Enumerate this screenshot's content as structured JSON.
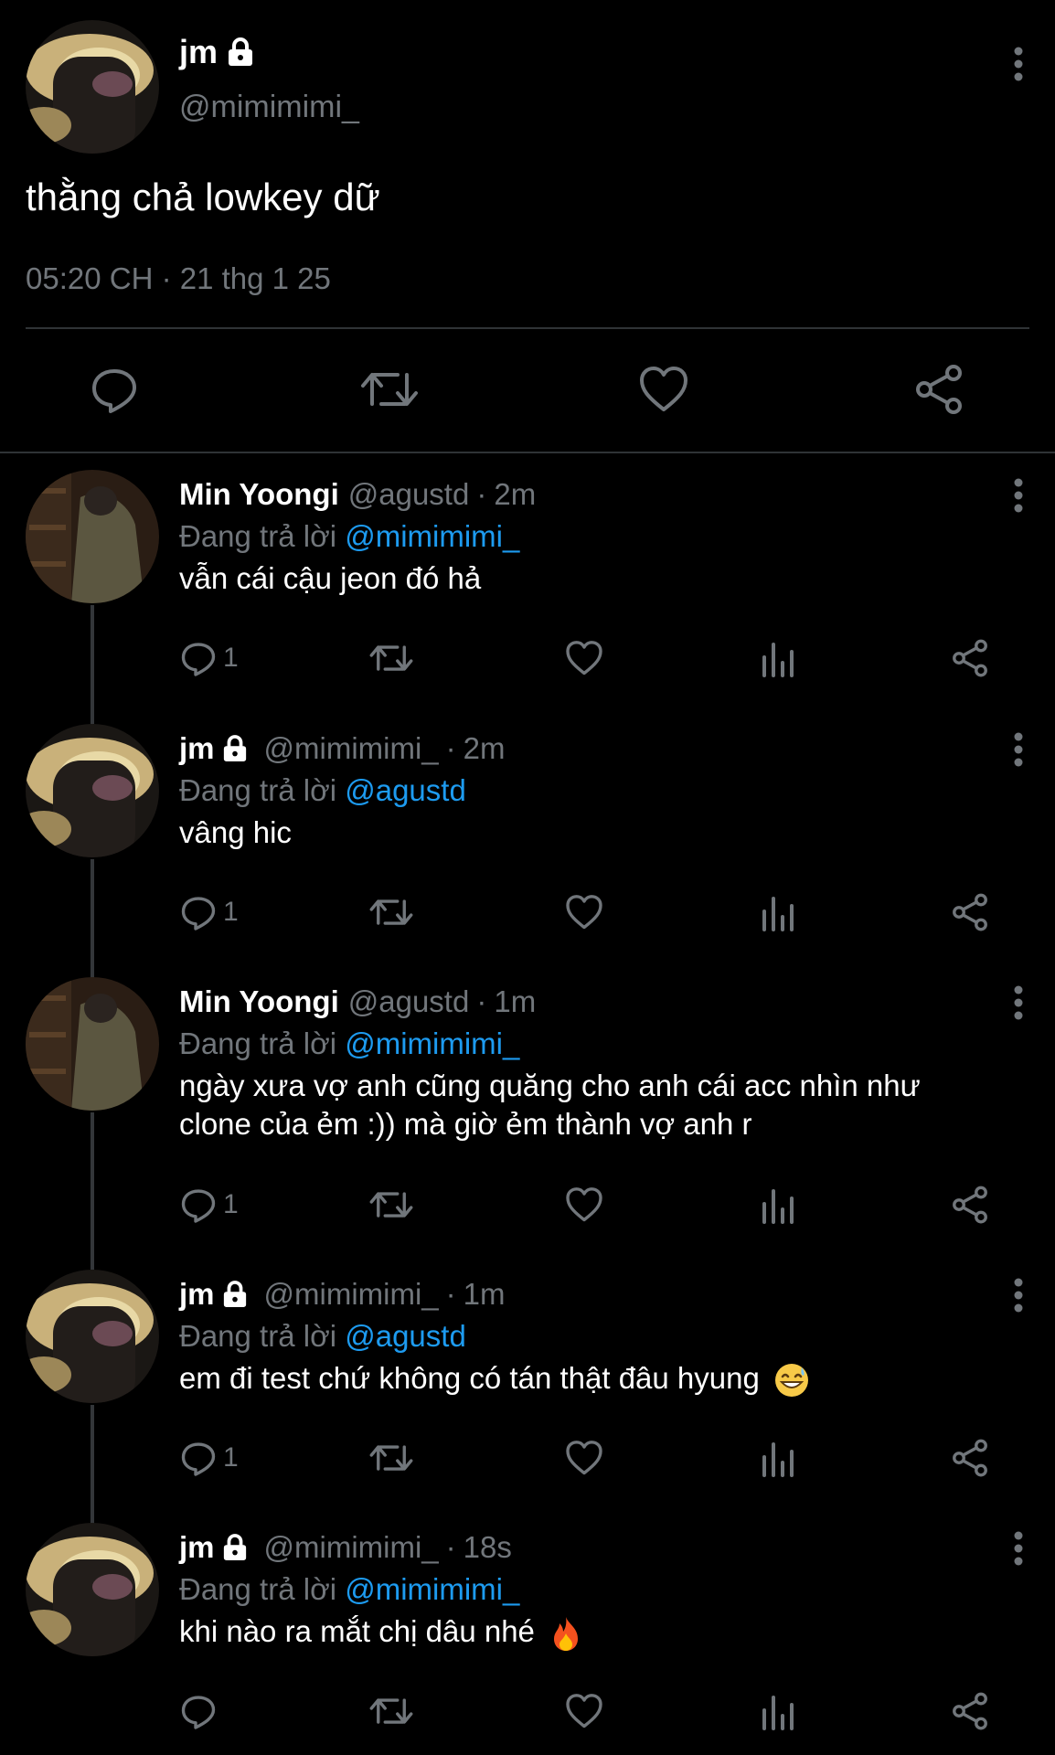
{
  "main_tweet": {
    "name": "jm",
    "handle": "@mimimimi_",
    "text": "thằng chả lowkey dữ",
    "timestamp": "05:20 CH · 21 thg 1 25",
    "actions": [
      "reply-icon",
      "retweet-icon",
      "like-icon",
      "share-icon"
    ]
  },
  "replying_prefix": "Đang trả lời",
  "replies": [
    {
      "name": "Min Yoongi",
      "handle": "@agustd",
      "time": "2m",
      "replying_to": "@mimimimi_",
      "text": "vẫn cái cậu jeon đó hả",
      "reply_count": "1",
      "locked": false,
      "avatar": "green"
    },
    {
      "name": "jm",
      "handle": "@mimimimi_",
      "time": "2m",
      "replying_to": "@agustd",
      "text": "vâng hic",
      "reply_count": "1",
      "locked": true,
      "avatar": "gold"
    },
    {
      "name": "Min Yoongi",
      "handle": "@agustd",
      "time": "1m",
      "replying_to": "@mimimimi_",
      "text": "ngày xưa vợ anh cũng quăng cho anh cái acc nhìn như clone của ẻm :)) mà giờ ẻm thành vợ anh r",
      "reply_count": "1",
      "locked": false,
      "avatar": "green"
    },
    {
      "name": "jm",
      "handle": "@mimimimi_",
      "time": "1m",
      "replying_to": "@agustd",
      "text": "em đi test chứ không có tán thật đâu hyung",
      "emoji": "grinning-sweat-emoji",
      "reply_count": "1",
      "locked": true,
      "avatar": "gold"
    },
    {
      "name": "jm",
      "handle": "@mimimimi_",
      "time": "18s",
      "replying_to": "@mimimimi_",
      "text": "khi nào ra mắt chị dâu nhé",
      "emoji": "fire-emoji",
      "reply_count": "",
      "locked": true,
      "avatar": "gold"
    }
  ],
  "colors": {
    "background": "#000000",
    "text": "#e7e9ea",
    "secondary": "#71767b",
    "mention": "#1d9bf0",
    "divider": "#2f3336"
  }
}
